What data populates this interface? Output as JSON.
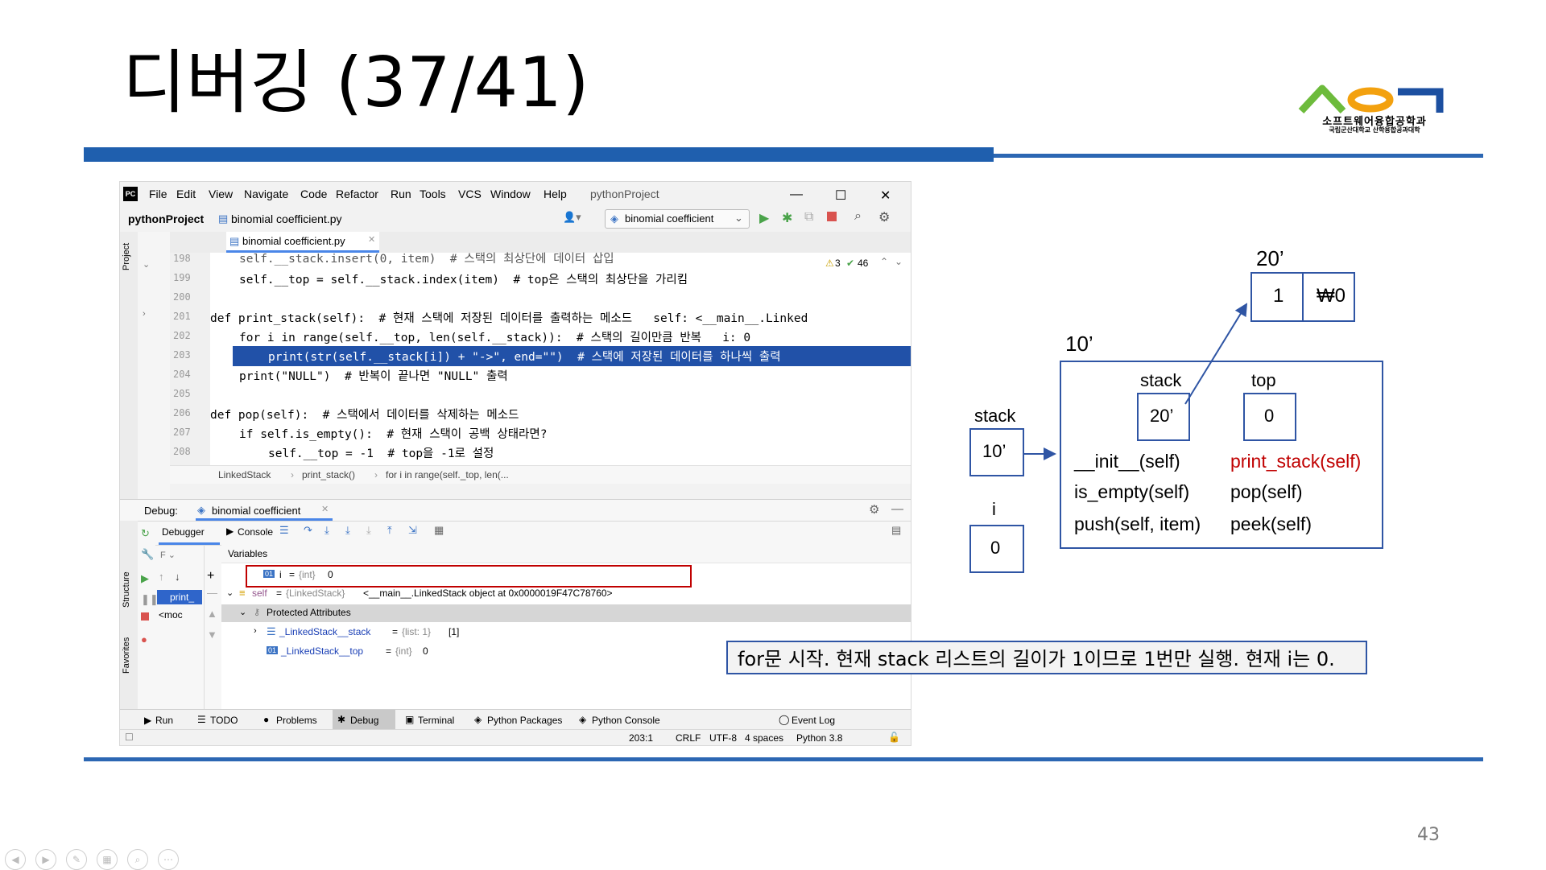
{
  "slide": {
    "title": "디버깅 (37/41)",
    "page_number": "43",
    "logo": {
      "line1": "소프트웨어융합공학과",
      "line2": "국립군산대학교 산학융합공과대학"
    }
  },
  "ide": {
    "app_icon": "PC",
    "menu": [
      "File",
      "Edit",
      "View",
      "Navigate",
      "Code",
      "Refactor",
      "Run",
      "Tools",
      "VCS",
      "Window",
      "Help"
    ],
    "window_title": "pythonProject",
    "breadcrumb": {
      "project": "pythonProject",
      "file": "binomial coefficient.py"
    },
    "run_config": "binomial coefficient",
    "editor_tab": "binomial coefficient.py",
    "side_tab_project": "Project",
    "inspections": {
      "warnings": "3",
      "ok": "46"
    },
    "code_lines": [
      {
        "n": "198",
        "text": "self.__stack.insert(0, item)  # 스택의 최상단에 데이터 삽입"
      },
      {
        "n": "199",
        "text": "self.__top = self.__stack.index(item)  # top은 스택의 최상단을 가리킴"
      },
      {
        "n": "200",
        "text": ""
      },
      {
        "n": "201",
        "text": "def print_stack(self):  # 현재 스택에 저장된 데이터를 출력하는 메소드   self: <__main__.Linked"
      },
      {
        "n": "202",
        "text": "for i in range(self.__top, len(self.__stack)):  # 스택의 길이만큼 반복   i: 0"
      },
      {
        "n": "203",
        "text": "print(str(self.__stack[i]) + \"->\", end=\"\")  # 스택에 저장된 데이터를 하나씩 출력"
      },
      {
        "n": "204",
        "text": "print(\"NULL\")  # 반복이 끝나면 \"NULL\" 출력"
      },
      {
        "n": "205",
        "text": ""
      },
      {
        "n": "206",
        "text": "def pop(self):  # 스택에서 데이터를 삭제하는 메소드"
      },
      {
        "n": "207",
        "text": "if self.is_empty():  # 현재 스택이 공백 상태라면?"
      },
      {
        "n": "208",
        "text": "self.__top = -1  # top을 -1로 설정"
      }
    ],
    "editor_breadcrumb": [
      "LinkedStack",
      "print_stack()",
      "for i in range(self._top, len(..."
    ],
    "debug": {
      "label": "Debug:",
      "config_tab": "binomial coefficient",
      "tabs": [
        "Debugger",
        "Console"
      ],
      "variables_header": "Variables",
      "frame_item": "print_",
      "frame_item2": "<moc",
      "variables": [
        {
          "name": "i",
          "type": "{int}",
          "value": "0",
          "badge": "01"
        },
        {
          "name": "self",
          "type": "{LinkedStack}",
          "value": "<__main__.LinkedStack object at 0x0000019F47C78760>"
        },
        {
          "name": "Protected Attributes",
          "type": "",
          "value": ""
        },
        {
          "name": "_LinkedStack__stack",
          "type": "{list: 1}",
          "value": "[1]"
        },
        {
          "name": "_LinkedStack__top",
          "type": "{int}",
          "value": "0",
          "badge": "01"
        }
      ],
      "side_tabs": [
        "Structure",
        "Favorites"
      ]
    },
    "bottom_tabs": [
      "Run",
      "TODO",
      "Problems",
      "Debug",
      "Terminal",
      "Python Packages",
      "Python Console"
    ],
    "event_log": "Event Log",
    "status": {
      "position": "203:1",
      "line_sep": "CRLF",
      "encoding": "UTF-8",
      "indent": "4 spaces",
      "interpreter": "Python 3.8"
    }
  },
  "diagram": {
    "node_address": "20’",
    "node_data": "1",
    "node_link": "₩0",
    "object_address": "10’",
    "field_stack_label": "stack",
    "field_stack_value": "20’",
    "field_top_label": "top",
    "field_top_value": "0",
    "methods": [
      "__init__(self)",
      "is_empty(self)",
      "push(self, item)",
      "print_stack(self)",
      "pop(self)",
      "peek(self)"
    ],
    "var_stack_label": "stack",
    "var_stack_value": "10’",
    "var_i_label": "i",
    "var_i_value": "0",
    "highlight_color": "#c00000"
  },
  "caption": "for문 시작. 현재 stack 리스트의 길이가 1이므로 1번만 실행. 현재 i는 0."
}
